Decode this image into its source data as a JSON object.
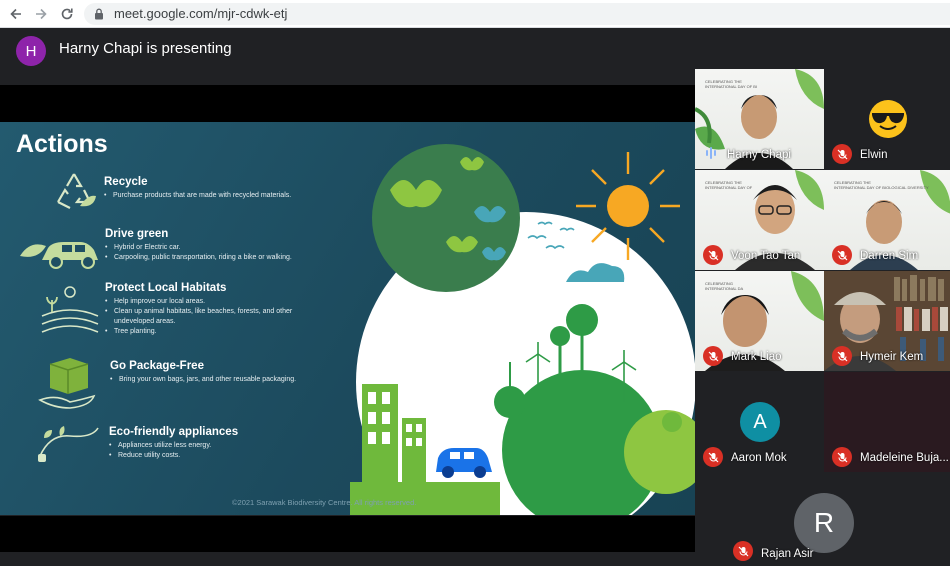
{
  "browser": {
    "url": "meet.google.com/mjr-cdwk-etj"
  },
  "meet": {
    "presenter_initial": "H",
    "presenting_label": "Harny Chapi is presenting"
  },
  "slide": {
    "title": "Actions",
    "actions": [
      {
        "heading": "Recycle",
        "bullets": [
          "Purchase products that are made with recycled materials."
        ]
      },
      {
        "heading": "Drive green",
        "bullets": [
          "Hybrid or Electric car.",
          "Carpooling, public transportation, riding a bike or walking."
        ]
      },
      {
        "heading": "Protect Local Habitats",
        "bullets": [
          "Help improve our local areas.",
          "Clean up animal habitats, like beaches, forests, and other undeveloped areas.",
          "Tree planting."
        ]
      },
      {
        "heading": "Go Package-Free",
        "bullets": [
          "Bring your own bags, jars, and other reusable packaging."
        ]
      },
      {
        "heading": "Eco-friendly appliances",
        "bullets": [
          "Appliances utilize less energy.",
          "Reduce utility costs."
        ]
      }
    ],
    "footer": "©2021 Sarawak Biodiversity Centre. All rights reserved."
  },
  "participants": [
    {
      "name": "Harny Chapi",
      "muted": false
    },
    {
      "name": "Elwin",
      "muted": true
    },
    {
      "name": "Voon Tao Tan",
      "muted": true
    },
    {
      "name": "Darren Sim",
      "muted": true
    },
    {
      "name": "Mark Liao",
      "muted": true
    },
    {
      "name": "Hymeir Kem",
      "muted": true
    },
    {
      "name": "Aaron Mok",
      "muted": true,
      "initial": "A"
    },
    {
      "name": "Madeleine Buja...",
      "muted": true
    },
    {
      "name": "Rajan Asir",
      "muted": true,
      "initial": "R"
    }
  ],
  "colors": {
    "presenter_avatar": "#8e24aa",
    "aaron_avatar": "#0f8fa3",
    "rajan_avatar": "#5f6368",
    "mic_off": "#d93025",
    "slide_bg": "#1f4f63"
  }
}
